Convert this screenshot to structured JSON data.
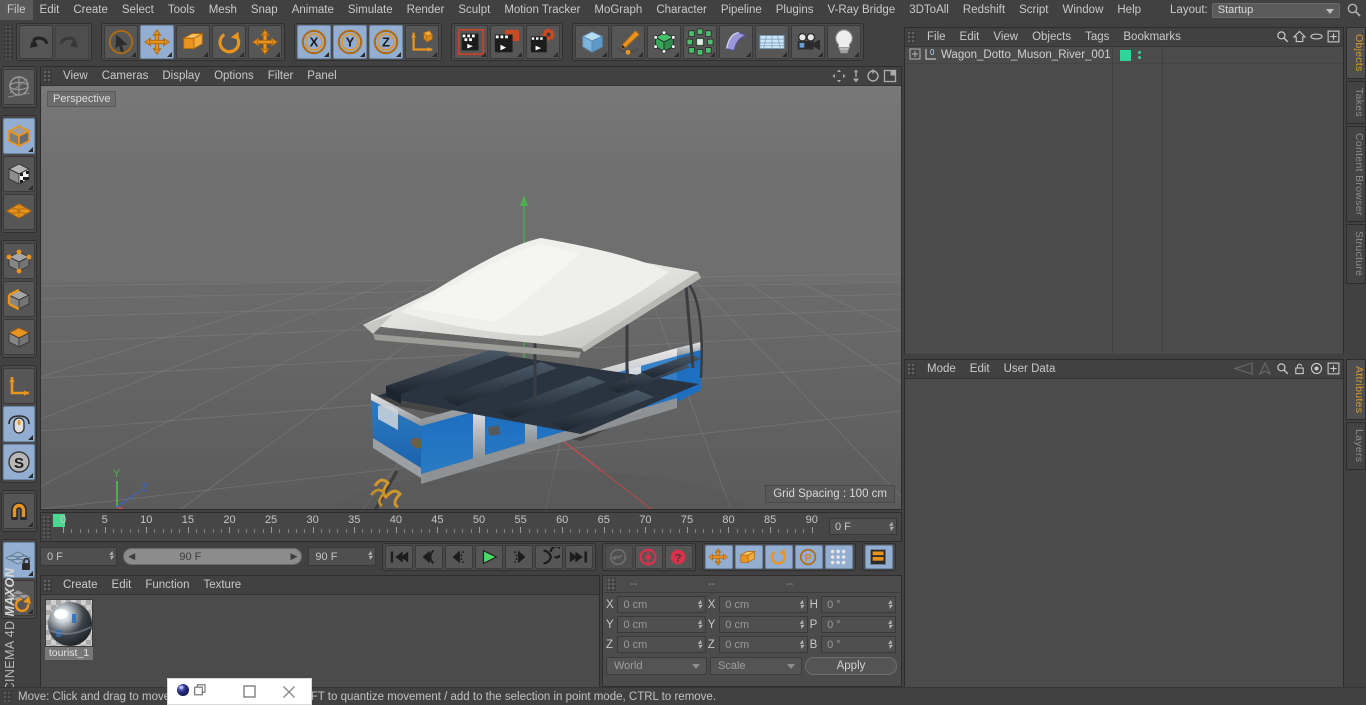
{
  "app": {
    "brand_top": "MAXON",
    "brand_bottom": "CINEMA 4D"
  },
  "menubar": {
    "items": [
      "File",
      "Edit",
      "Create",
      "Select",
      "Tools",
      "Mesh",
      "Snap",
      "Animate",
      "Simulate",
      "Render",
      "Sculpt",
      "Motion Tracker",
      "MoGraph",
      "Character",
      "Pipeline",
      "Plugins",
      "V-Ray Bridge",
      "3DToAll",
      "Redshift",
      "Script",
      "Window",
      "Help"
    ],
    "layout_label": "Layout:",
    "layout_value": "Startup",
    "search_icon": "search-icon"
  },
  "toolbar": {
    "groups": [
      {
        "name": "undo-redo",
        "buttons": [
          {
            "icon": "undo-icon",
            "label": "Undo",
            "selected": false,
            "disabled": false
          },
          {
            "icon": "redo-icon",
            "label": "Redo",
            "selected": false,
            "disabled": true
          }
        ]
      },
      {
        "name": "tools",
        "buttons": [
          {
            "icon": "live-selection-icon",
            "label": "Live Selection",
            "selected": false,
            "disabled": false
          },
          {
            "icon": "move-icon",
            "label": "Move",
            "selected": true,
            "disabled": false
          },
          {
            "icon": "scale-icon",
            "label": "Scale",
            "selected": false,
            "disabled": false
          },
          {
            "icon": "rotate-icon",
            "label": "Rotate",
            "selected": false,
            "disabled": false
          },
          {
            "icon": "move-axis-icon",
            "label": "Move Axis",
            "selected": false,
            "disabled": false
          }
        ]
      },
      {
        "name": "axis-locks",
        "buttons": [
          {
            "icon": "x-axis-icon",
            "label": "X",
            "selected": true,
            "disabled": false
          },
          {
            "icon": "y-axis-icon",
            "label": "Y",
            "selected": true,
            "disabled": false
          },
          {
            "icon": "z-axis-icon",
            "label": "Z",
            "selected": true,
            "disabled": false
          },
          {
            "icon": "world-coordinate-icon",
            "label": "World/Object",
            "selected": false,
            "disabled": false
          }
        ]
      },
      {
        "name": "render",
        "buttons": [
          {
            "icon": "render-view-icon",
            "label": "Render View",
            "selected": false,
            "disabled": false
          },
          {
            "icon": "render-to-picture-viewer-icon",
            "label": "Render to Picture Viewer",
            "selected": false,
            "disabled": false
          },
          {
            "icon": "render-settings-icon",
            "label": "Edit Render Settings",
            "selected": false,
            "disabled": false
          }
        ]
      },
      {
        "name": "create",
        "buttons": [
          {
            "icon": "cube-primitive-icon",
            "label": "Cube",
            "selected": false,
            "disabled": false
          },
          {
            "icon": "spline-pen-icon",
            "label": "Pen",
            "selected": false,
            "disabled": false
          },
          {
            "icon": "nurbs-icon",
            "label": "Subdivision Surface",
            "selected": false,
            "disabled": false
          },
          {
            "icon": "array-icon",
            "label": "Array",
            "selected": false,
            "disabled": false
          },
          {
            "icon": "bend-deformer-icon",
            "label": "Bend",
            "selected": false,
            "disabled": false
          },
          {
            "icon": "floor-environment-icon",
            "label": "Floor",
            "selected": false,
            "disabled": false
          },
          {
            "icon": "camera-icon",
            "label": "Camera",
            "selected": false,
            "disabled": false
          },
          {
            "icon": "light-icon",
            "label": "Light",
            "selected": false,
            "disabled": false
          }
        ]
      }
    ]
  },
  "lefttools": {
    "buttons": [
      {
        "icon": "viewport-globe-icon",
        "label": "Make Editable / Viewport",
        "selected": false
      },
      {
        "icon": "model-mode-icon",
        "label": "Model Mode",
        "selected": true
      },
      {
        "icon": "texture-mode-icon",
        "label": "Texture Mode",
        "selected": false
      },
      {
        "icon": "workplane-icon",
        "label": "Workplane",
        "selected": false
      },
      {
        "icon": "points-mode-icon",
        "label": "Points Mode",
        "selected": false
      },
      {
        "icon": "edges-mode-icon",
        "label": "Edges Mode",
        "selected": false
      },
      {
        "icon": "polygons-mode-icon",
        "label": "Polygons Mode",
        "selected": false
      },
      {
        "icon": "axis-mode-icon",
        "label": "Enable Axis Modification",
        "selected": false
      },
      {
        "icon": "viewport-solo-icon",
        "label": "Enable Snapping",
        "selected": true
      },
      {
        "icon": "snap-s-icon",
        "label": "Snap Settings",
        "selected": true
      },
      {
        "icon": "magnet-icon",
        "label": "Magnet",
        "selected": false
      },
      {
        "icon": "workplane-lock-icon",
        "label": "Lock Workplane",
        "selected": true
      },
      {
        "icon": "workplane-rotate-icon",
        "label": "Planar Workplane Rotate",
        "selected": false
      }
    ]
  },
  "viewport": {
    "menu": [
      "View",
      "Cameras",
      "Display",
      "Options",
      "Filter",
      "Panel"
    ],
    "corner_icons": [
      "pan-icon",
      "dolly-icon",
      "rotate-view-icon",
      "maximize-view-icon"
    ],
    "label": "Perspective",
    "grid_spacing": "Grid Spacing : 100 cm",
    "axis_gizmo": {
      "x": "X",
      "y": "Y",
      "z": "Z"
    },
    "scene_description": "Tourist trolley wagon model with white roof, blue side panels and bench seats"
  },
  "objects_manager": {
    "menu": [
      "File",
      "Edit",
      "View",
      "Objects",
      "Tags",
      "Bookmarks"
    ],
    "header_icons": [
      "search-icon",
      "home-icon",
      "eye-icon",
      "expand-icon"
    ],
    "items": [
      {
        "name": "Wagon_Dotto_Muson_River_001",
        "level_badge": "0",
        "visible_dot_color": "#2fd69a"
      }
    ]
  },
  "attributes_manager": {
    "menu": [
      "Mode",
      "Edit",
      "User Data"
    ],
    "header_icons": [
      "prev-icon",
      "next-icon",
      "search-icon",
      "lock-icon",
      "target-icon",
      "expand-icon"
    ]
  },
  "right_tabs": {
    "top": [
      {
        "label": "Objects",
        "active": true
      },
      {
        "label": "Takes",
        "active": false
      },
      {
        "label": "Content Browser",
        "active": false
      },
      {
        "label": "Structure",
        "active": false
      }
    ],
    "bottom": [
      {
        "label": "Attributes",
        "active": true
      },
      {
        "label": "Layers",
        "active": false
      }
    ]
  },
  "timeline": {
    "ticks": [
      "0",
      "5",
      "10",
      "15",
      "20",
      "25",
      "30",
      "35",
      "40",
      "45",
      "50",
      "55",
      "60",
      "65",
      "70",
      "75",
      "80",
      "85",
      "90"
    ],
    "current_frame_field": "0 F",
    "playhead_frame": 0
  },
  "transport": {
    "current_frame": "0 F",
    "range_start": "0 F",
    "range_end": "90 F",
    "end_frame": "90 F",
    "buttons": [
      {
        "icon": "go-to-start-icon",
        "label": "Go to Start",
        "selected": false,
        "disabled": false
      },
      {
        "icon": "previous-key-icon",
        "label": "Go to Previous Key",
        "selected": false,
        "disabled": false
      },
      {
        "icon": "previous-frame-icon",
        "label": "Go to Previous Frame",
        "selected": false,
        "disabled": false
      },
      {
        "icon": "play-icon",
        "label": "Play Forwards",
        "selected": false,
        "disabled": false
      },
      {
        "icon": "next-frame-icon",
        "label": "Go to Next Frame",
        "selected": false,
        "disabled": false
      },
      {
        "icon": "next-key-icon",
        "label": "Go to Next Key",
        "selected": false,
        "disabled": false
      },
      {
        "icon": "go-to-end-icon",
        "label": "Go to End",
        "selected": false,
        "disabled": false
      }
    ],
    "record_buttons": [
      {
        "icon": "autokey-icon",
        "label": "Autokeying",
        "selected": false,
        "disabled": true
      },
      {
        "icon": "record-active-objects-icon",
        "label": "Record Active Objects",
        "selected": false,
        "disabled": false
      },
      {
        "icon": "keyframe-selection-icon",
        "label": "Keyframe Selection",
        "selected": false,
        "disabled": false
      }
    ],
    "key_toggles": [
      {
        "icon": "position-key-icon",
        "label": "Position",
        "selected": true
      },
      {
        "icon": "scale-key-icon",
        "label": "Scale",
        "selected": true
      },
      {
        "icon": "rotation-key-icon",
        "label": "Rotation",
        "selected": true
      },
      {
        "icon": "pla-key-icon",
        "label": "Point Level Animation",
        "selected": true
      },
      {
        "icon": "parameter-key-icon",
        "label": "Parameter",
        "selected": true
      }
    ],
    "timeline_toggle": {
      "icon": "animation-mode-icon",
      "label": "Animation Mode",
      "selected": true
    }
  },
  "material_manager": {
    "menu": [
      "Create",
      "Edit",
      "Function",
      "Texture"
    ],
    "materials": [
      {
        "name": "tourist_1"
      }
    ]
  },
  "coordinates_manager": {
    "column_headers": [
      "--",
      "--",
      "--"
    ],
    "position": {
      "label_x": "X",
      "label_y": "Y",
      "label_z": "Z",
      "x": "0 cm",
      "y": "0 cm",
      "z": "0 cm"
    },
    "size": {
      "label_x": "X",
      "label_y": "Y",
      "label_z": "Z",
      "x": "0 cm",
      "y": "0 cm",
      "z": "0 cm"
    },
    "rotation": {
      "label_h": "H",
      "label_p": "P",
      "label_b": "B",
      "h": "0 °",
      "p": "0 °",
      "b": "0 °"
    },
    "coord_system": "World",
    "size_mode": "Scale",
    "apply_label": "Apply"
  },
  "statusbar": {
    "message": "Move: Click and drag to move the selected elements. SHIFT to quantize movement / add to the selection in point mode, CTRL to remove."
  },
  "overlay_window": {
    "icons": [
      "app-orb-icon",
      "restore-icon",
      "maximize-icon",
      "close-icon"
    ]
  },
  "colors": {
    "accent_orange": "#d99a2b",
    "selection_blue": "#93aed0",
    "panel_bg": "#4b4b4b",
    "chrome_bg": "#414141",
    "green_tag": "#2fd69a",
    "axis_x": "#d04040",
    "axis_y": "#3fae3f",
    "axis_z": "#4060d0"
  }
}
